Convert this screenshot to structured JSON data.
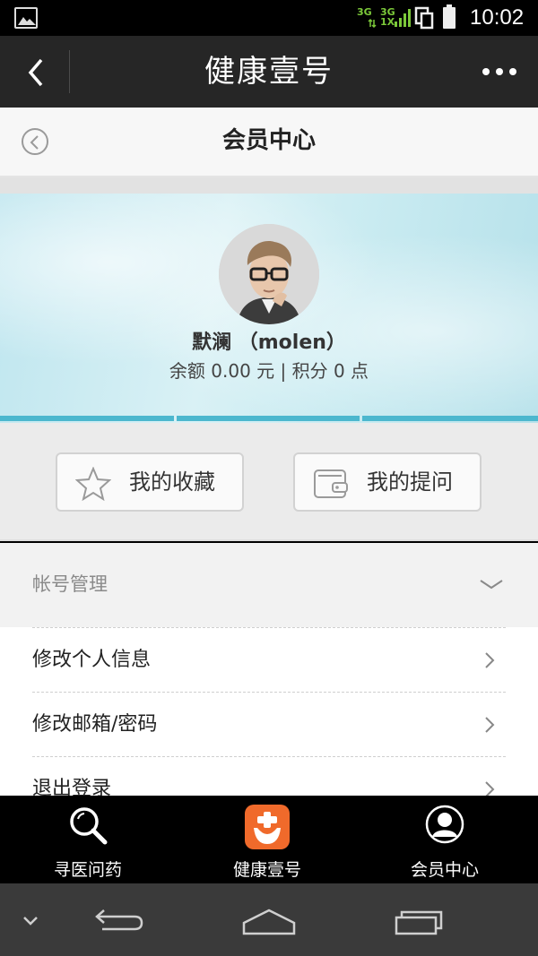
{
  "status_bar": {
    "network_1": "3G",
    "network_2": "3G",
    "network_2_sub": "1X",
    "time": "10:02",
    "icons": [
      "image-icon",
      "signal-icon",
      "copy-icon",
      "battery-icon"
    ]
  },
  "app_header": {
    "title": "健康壹号",
    "back_icon": "chevron-left-icon",
    "more_icon": "more-icon"
  },
  "sub_header": {
    "title": "会员中心",
    "back_icon": "circle-back-icon"
  },
  "profile": {
    "name": "默澜 （molen）",
    "balance_line": "余额 0.00 元 | 积分 0 点",
    "avatar_icon": "avatar-photo"
  },
  "actions": {
    "favorites_label": "我的收藏",
    "questions_label": "我的提问"
  },
  "account": {
    "section_title": "帐号管理",
    "items": [
      {
        "label": "修改个人信息"
      },
      {
        "label": "修改邮箱/密码"
      },
      {
        "label": "退出登录"
      }
    ]
  },
  "tab_bar": {
    "tabs": [
      {
        "label": "寻医问药",
        "icon": "search-icon"
      },
      {
        "label": "健康壹号",
        "icon": "home-logo-icon"
      },
      {
        "label": "会员中心",
        "icon": "user-icon"
      }
    ]
  },
  "colors": {
    "header_bg": "#262626",
    "accent_orange": "#f06a2b",
    "banner_stripe": "#4cb7ce"
  }
}
